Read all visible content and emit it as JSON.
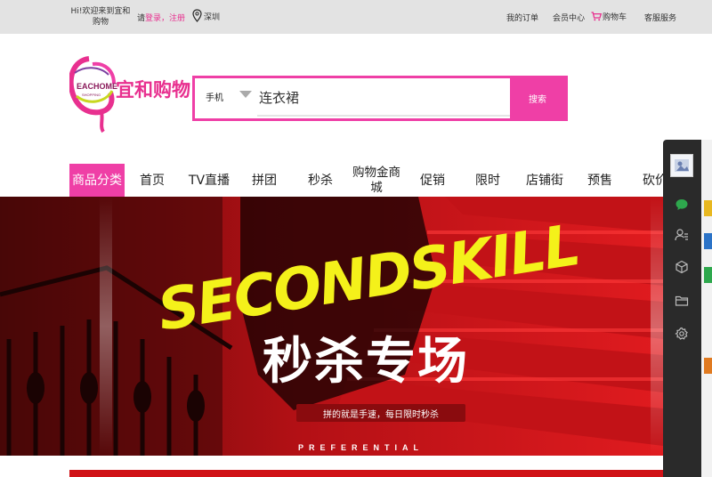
{
  "topbar": {
    "welcome": "Hi!欢迎来到宜和购物",
    "login_prefix": "请",
    "login_link": "登录",
    "sep": "，",
    "register_link": "注册",
    "location": "深圳",
    "my_orders": "我的订单",
    "member_center": "会员中心",
    "cart": "购物车",
    "customer_service": "客服服务"
  },
  "logo": {
    "brand_en": "EACHOME",
    "brand_en_sub": "SHOPPING",
    "brand_cn": "宜和购物"
  },
  "search": {
    "category": "手机",
    "placeholder": "连衣裙",
    "button": "搜索"
  },
  "nav": {
    "items": [
      "商品分类",
      "首页",
      "TV直播",
      "拼团",
      "秒杀",
      "购物金商城",
      "促销",
      "限时",
      "店铺街",
      "预售",
      "砍价"
    ],
    "active_index": 0
  },
  "banner": {
    "headline_en": "SECONDSKILL",
    "headline_cn": "秒杀专场",
    "tagline": "拼的就是手速，每日限时秒杀",
    "footer": "PREFERENTIAL"
  },
  "colors": {
    "accent": "#ef3fa6",
    "topbar_bg": "#e3e3e3",
    "banner_red": "#d01217",
    "banner_yellow": "#f4f11a",
    "panel_bg": "#2a2a2a"
  },
  "right_panel": {
    "icons": [
      "avatar",
      "chat-icon",
      "user-list-icon",
      "cube-icon",
      "folder-icon",
      "settings-icon"
    ]
  }
}
